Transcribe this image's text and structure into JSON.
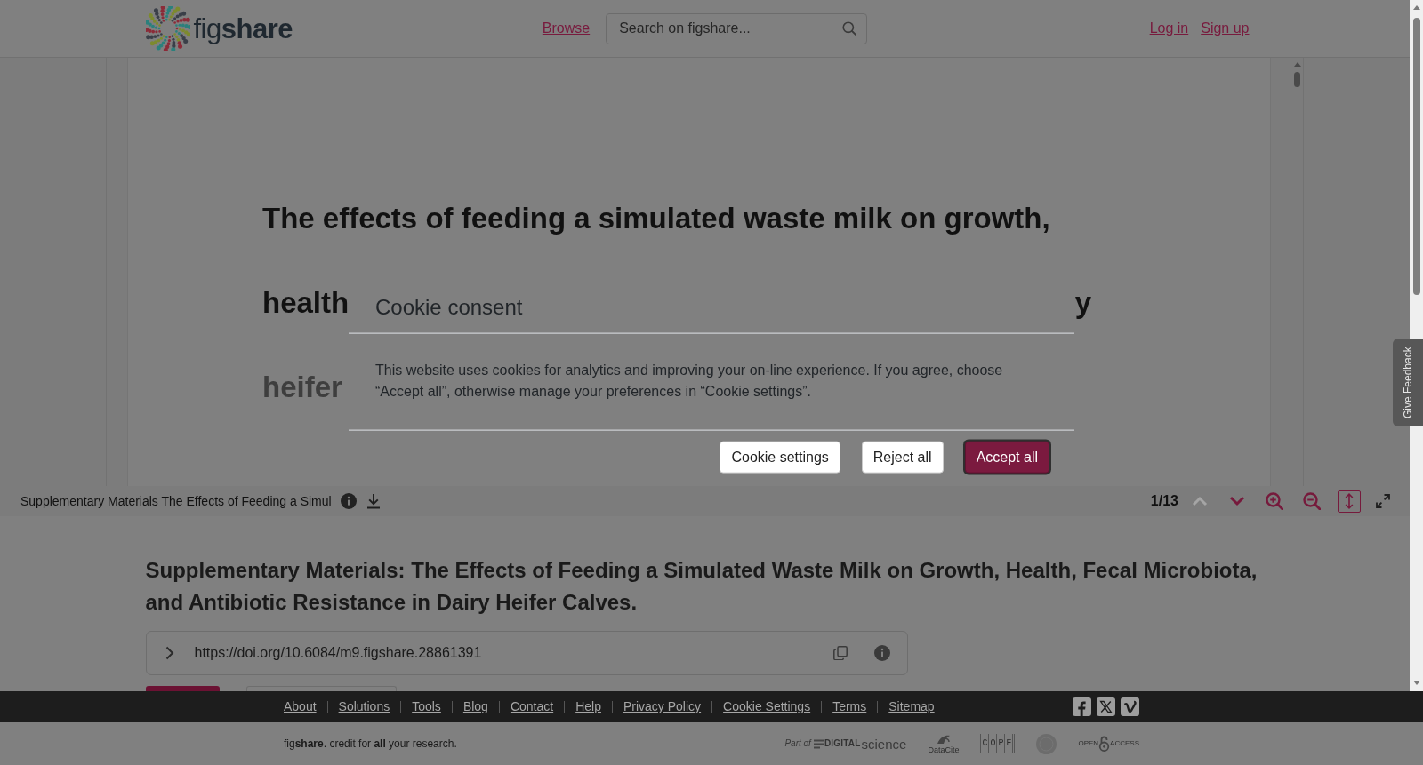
{
  "header": {
    "logo_text": "fig**share**",
    "nav": [
      "Browse"
    ],
    "search": {
      "placeholder": "Search on figshare..."
    },
    "auth_links": [
      "Log in",
      "Sign up"
    ]
  },
  "document": {
    "lines": [
      {
        "segments": [
          "The effects of feeding a simulated waste milk on growth,"
        ],
        "faded": false
      },
      {
        "segments": [
          "health",
          "y"
        ],
        "faded": false
      },
      {
        "segments": [
          "heifer"
        ],
        "faded": true
      }
    ]
  },
  "viewer_toolbar": {
    "file_name": "Supplementary Materials The Effects of Feeding a Simul",
    "page_indicator": "1/13",
    "controls": [
      {
        "kind": "previous-page",
        "disabled": true,
        "selected": false
      },
      {
        "kind": "next-page",
        "disabled": false,
        "selected": false
      },
      {
        "kind": "zoom-in",
        "disabled": false,
        "selected": false
      },
      {
        "kind": "zoom-out",
        "disabled": false,
        "selected": false
      },
      {
        "kind": "fit-height",
        "disabled": false,
        "selected": true
      },
      {
        "kind": "fullscreen",
        "disabled": false,
        "selected": false
      }
    ]
  },
  "article": {
    "title": "Supplementary Materials: The Effects of Feeding a Simulated Waste Milk on Growth, Health, Fecal Microbiota, and Antibiotic Resistance in Dairy Heifer Calves.",
    "doi": "https://doi.org/10.6084/m9.figshare.28861391"
  },
  "footer": {
    "links": [
      "About",
      "Solutions",
      "Tools",
      "Blog",
      "Contact",
      "Help",
      "Privacy Policy",
      "Cookie Settings",
      "Terms",
      "Sitemap"
    ],
    "tagline": "fig**share**. credit for **all** your research.",
    "partners": [
      {
        "kind": "digital-science",
        "texts": [
          "Part of",
          "DIGITAL",
          "science"
        ]
      },
      {
        "kind": "datacite",
        "texts": [
          "DataCite"
        ]
      },
      {
        "kind": "cope",
        "texts": [
          "COPE"
        ]
      },
      {
        "kind": "seal"
      },
      {
        "kind": "open-access",
        "texts": [
          "OPEN",
          "ACCESS"
        ]
      }
    ]
  },
  "feedback_tab": {
    "label": "Give Feedback"
  },
  "cookie_dialog": {
    "title": "Cookie consent",
    "text": "This website uses cookies for analytics and improving your on-line experience. If you agree, choose “Accept all”, otherwise manage your preferences in “Cookie settings”.",
    "buttons": [
      {
        "kind": "settings",
        "label": "Cookie settings",
        "focused": false
      },
      {
        "kind": "reject",
        "label": "Reject all",
        "focused": false
      },
      {
        "kind": "accept",
        "label": "Accept all",
        "focused": true
      }
    ]
  }
}
